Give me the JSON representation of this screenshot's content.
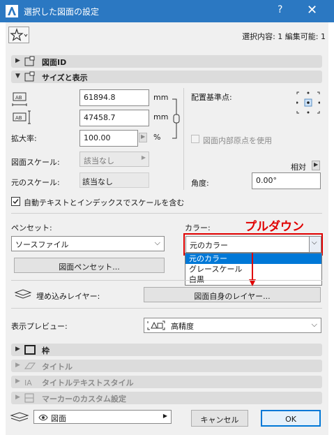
{
  "window": {
    "title": "選択した図面の設定",
    "help_glyph": "?",
    "close_glyph": "✕"
  },
  "header": {
    "selection_info": "選択内容: 1 編集可能: 1"
  },
  "sections": {
    "drawing_id": "図面ID",
    "size_display": "サイズと表示",
    "frame": "枠",
    "title": "タイトル",
    "title_text_style": "タイトルテキストスタイル",
    "marker_custom": "マーカーのカスタム設定"
  },
  "size": {
    "width_value": "61894.8",
    "height_value": "47458.7",
    "unit_mm": "mm",
    "scale_label": "拡大率:",
    "scale_value": "100.00",
    "percent": "%",
    "drawing_scale_label": "図面スケール:",
    "drawing_scale_value": "該当なし",
    "original_scale_label": "元のスケール:",
    "original_scale_value": "該当なし"
  },
  "anchor": {
    "label": "配置基準点:",
    "use_origin_label": "図面内部原点を使用",
    "relative_label": "相対",
    "angle_label": "角度:",
    "angle_value": "0.00°"
  },
  "auto_scale": {
    "checked": true,
    "label": "自動テキストとインデックスでスケールを含む"
  },
  "pen": {
    "label": "ペンセット:",
    "value": "ソースファイル",
    "button": "図面ペンセット..."
  },
  "color": {
    "label": "カラー:",
    "value": "元のカラー",
    "annotation": "プルダウン",
    "options": [
      "元のカラー",
      "グレースケール",
      "白黒"
    ],
    "annotation_color": "#e00000"
  },
  "layer": {
    "label": "埋め込みレイヤー:",
    "button": "図面自身のレイヤー..."
  },
  "preview": {
    "label": "表示プレビュー:",
    "value": "高精度"
  },
  "footer": {
    "view_value": "図面",
    "cancel": "キャンセル",
    "ok": "OK"
  }
}
